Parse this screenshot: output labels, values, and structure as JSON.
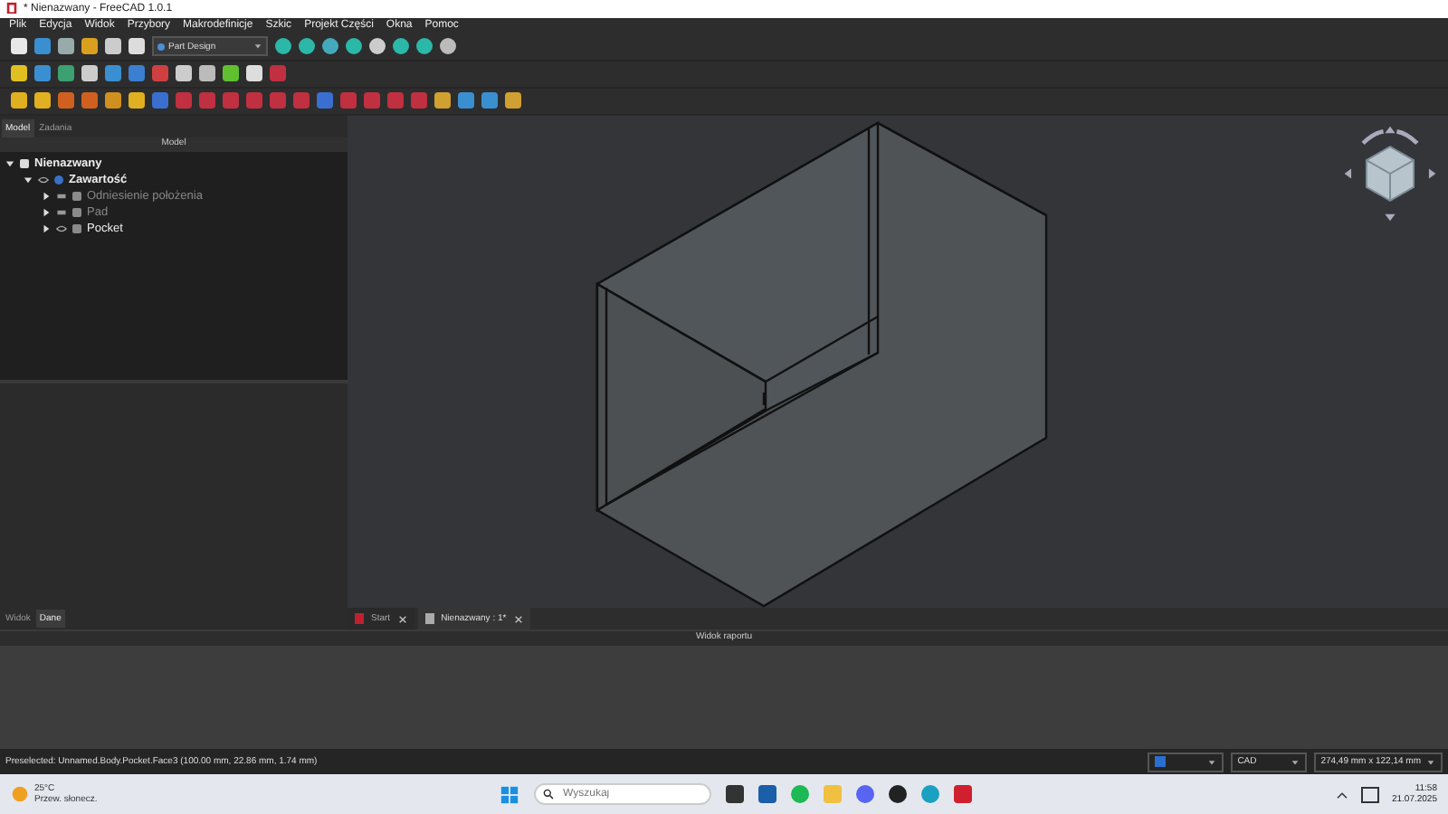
{
  "window": {
    "title": "* Nienazwany - FreeCAD 1.0.1"
  },
  "menu": [
    "Plik",
    "Edycja",
    "Widok",
    "Przybory",
    "Makrodefinicje",
    "Szkic",
    "Projekt Części",
    "Okna",
    "Pomoc"
  ],
  "workbench": {
    "value": "Part Design"
  },
  "left_tabs": [
    {
      "label": "Model",
      "selected": true
    },
    {
      "label": "Zadania",
      "selected": false
    }
  ],
  "panel_title": "Model",
  "tree": [
    {
      "label": "Nienazwany",
      "expanded": true,
      "visible": true,
      "children": [
        {
          "label": "Zawartość",
          "expanded": true,
          "visible": true,
          "children": [
            {
              "label": "Odniesienie położenia",
              "expanded": false,
              "visible": false
            },
            {
              "label": "Pad",
              "expanded": false,
              "visible": false
            },
            {
              "label": "Pocket",
              "expanded": false,
              "visible": true
            }
          ]
        }
      ]
    }
  ],
  "bottom_tabs": [
    {
      "label": "Widok",
      "selected": false
    },
    {
      "label": "Dane",
      "selected": true
    }
  ],
  "doc_tabs": [
    {
      "label": "Start",
      "selected": false
    },
    {
      "label": "Nienazwany : 1*",
      "selected": true
    }
  ],
  "report": {
    "title": "Widok raportu"
  },
  "status": {
    "message": "Preselected: Unnamed.Body.Pocket.Face3 (100.00 mm, 22.86 mm, 1.74 mm)",
    "nav_style": "CAD",
    "dimensions": "274,49 mm x 122,14 mm"
  },
  "taskbar": {
    "temperature": "25°C",
    "weather": "Przew. słonecz.",
    "search_placeholder": "Wyszukaj",
    "time": "11:58",
    "date": "21.07.2025"
  }
}
